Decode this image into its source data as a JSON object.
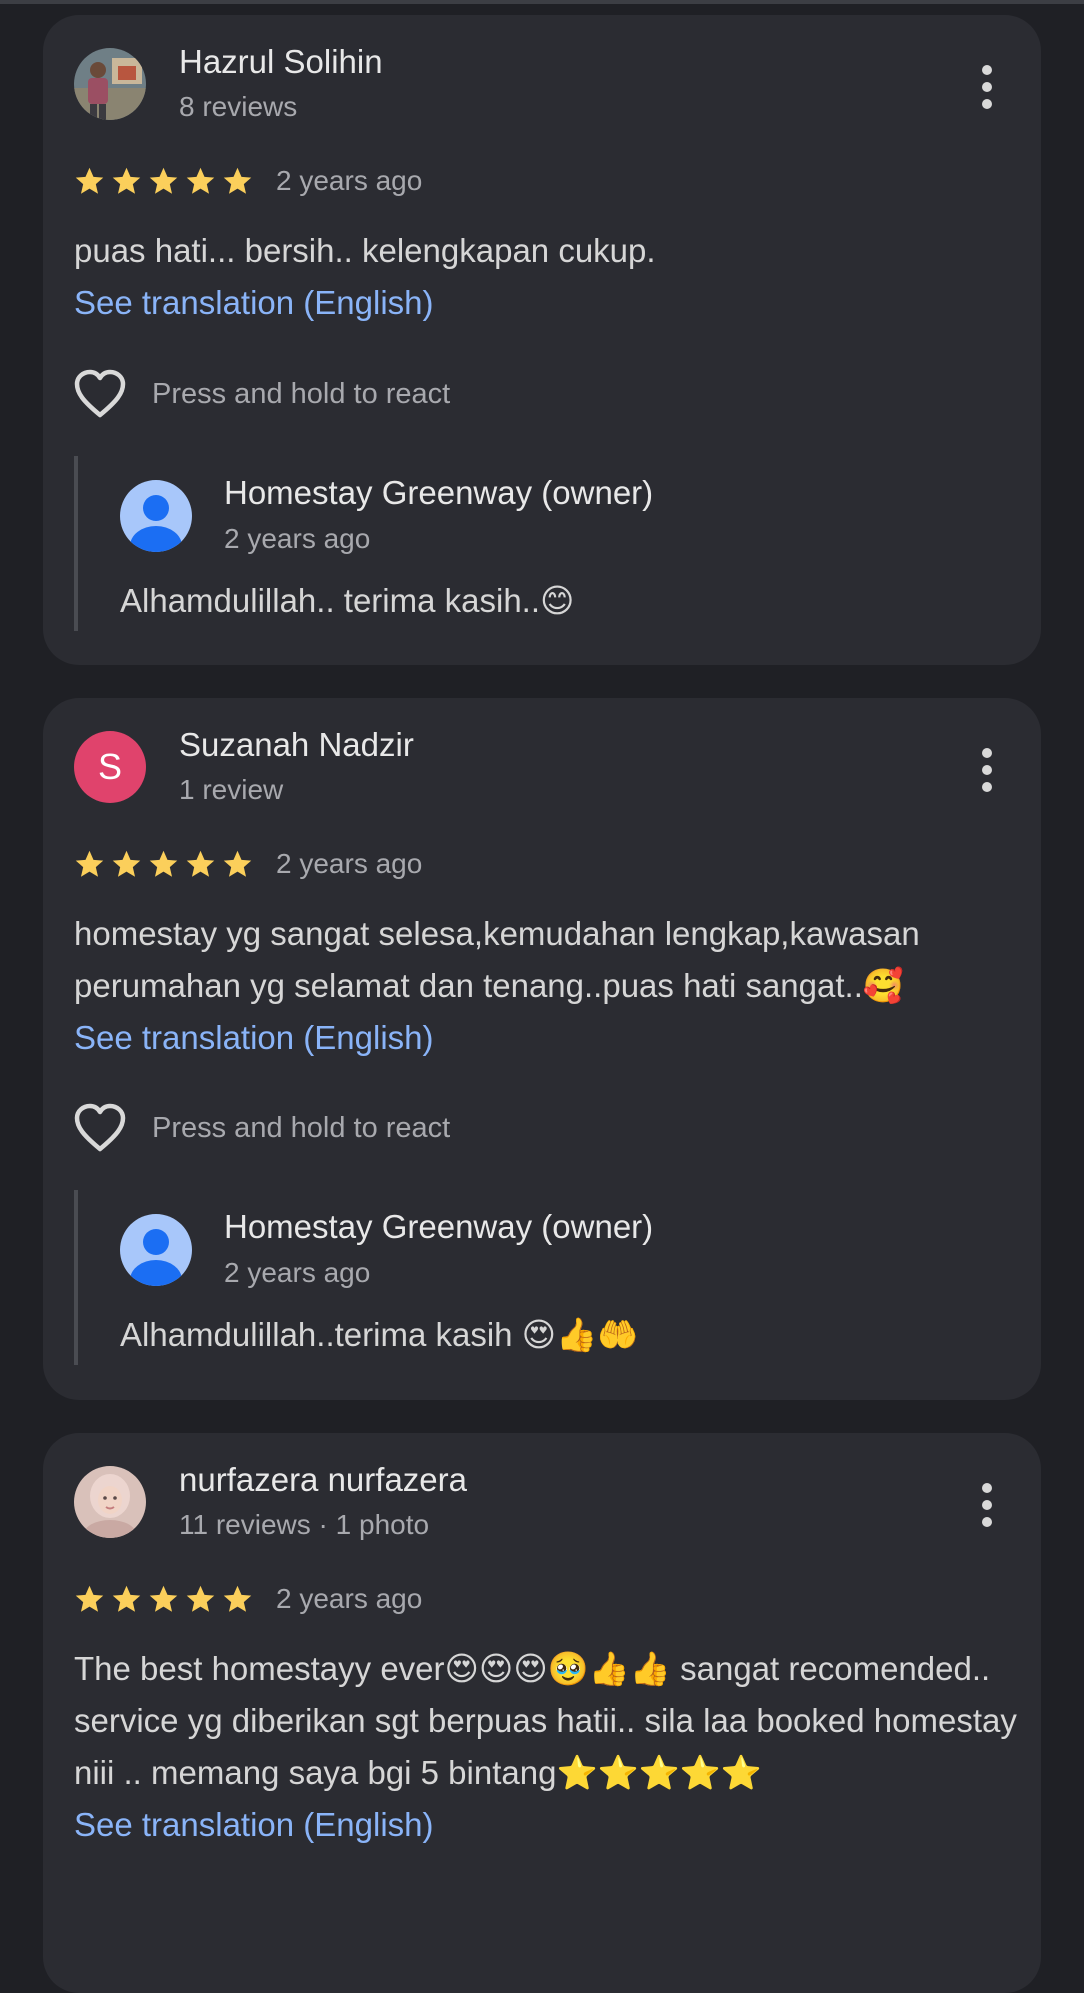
{
  "colors": {
    "page_bg": "#1f2025",
    "card_bg": "#2b2c32",
    "star": "#fbcf5b",
    "link": "#8ab4f8",
    "letter_avatar": "#e0436c",
    "owner_avatar": "#a8c7fa"
  },
  "reviews": [
    {
      "author": "Hazrul Solihin",
      "meta": "8 reviews",
      "rating": 5,
      "time": "2 years ago",
      "text": "puas hati... bersih.. kelengkapan cukup.",
      "see_translation": "See translation (English)",
      "react_label": "Press and hold to react",
      "owner_reply": {
        "name": "Homestay Greenway (owner)",
        "time": "2 years ago",
        "text": "Alhamdulillah.. terima kasih..😊"
      }
    },
    {
      "author": "Suzanah Nadzir",
      "avatar_letter": "S",
      "meta": "1 review",
      "rating": 5,
      "time": "2 years ago",
      "text": "homestay yg sangat selesa,kemudahan lengkap,kawasan perumahan yg selamat dan tenang..puas hati sangat..🥰",
      "see_translation": "See translation (English)",
      "react_label": "Press and hold to react",
      "owner_reply": {
        "name": "Homestay Greenway (owner)",
        "time": "2 years ago",
        "text": "Alhamdulillah..terima kasih 😍👍🤲"
      }
    },
    {
      "author": "nurfazera nurfazera",
      "meta": "11 reviews · 1 photo",
      "rating": 5,
      "time": "2 years ago",
      "text": "The best homestayy ever😍😍😍🥹👍👍 sangat recomended.. service yg diberikan sgt berpuas hatii.. sila laa booked homestay niii .. memang saya bgi 5 bintang⭐⭐⭐⭐⭐",
      "see_translation": "See translation (English)"
    }
  ],
  "icons": {
    "more": "more-vert-icon",
    "star": "star-icon",
    "heart": "heart-outline-icon",
    "person": "person-icon"
  }
}
